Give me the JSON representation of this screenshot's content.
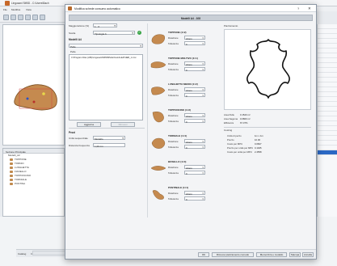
{
  "background_app": {
    "title": "Lingusani Sift5D - C:\\Users\\Bach",
    "menu": [
      "File",
      "Modifica",
      "Vista"
    ],
    "panel_title": "Sezione Principale",
    "tree_root": "Modelli_A2",
    "tree_items": [
      "TOPPONE",
      "TORNIO",
      "LUNGHETTA",
      "FIANELLO",
      "TOPPONCINO",
      "TORNIALE",
      "PUNTINA"
    ],
    "bottom_tabs": [
      "Catalog",
      "Impaginazione pagine",
      "apri pacchetto",
      "Applica e trasferisci pacchetto",
      "Extra"
    ]
  },
  "dialog": {
    "title": "Modifica schede consumo automatico",
    "help_label": "?",
    "close_label": "✕",
    "header": "Modelli A4 - 108",
    "left": {
      "magnification_label": "Maggiorazione (%)",
      "magnification_value": "1 - 0",
      "choice_label": "Scelta",
      "choice_value": "Tipologia A",
      "selection_title": "Modelli A4",
      "type_value": "Pelle",
      "list_label": "Pelle",
      "list_item": "C:\\Program Files (x86)\\Lingusani\\Sift5D\\Pelle\\Cuoio\\LEATHER_1.cmx",
      "apply_button": "Aggiorna",
      "remove_button": "Rimuovi",
      "shoes_title": "Pezzi",
      "unit_label": "Unità sequenziale",
      "unit_value": "Modello",
      "display_label": "Distanza frequenza",
      "display_value": "1,00 cm"
    },
    "pieces": [
      {
        "name": "TOPPONE (1×2)",
        "rotation": "Libero",
        "tolerance": "0"
      },
      {
        "name": "TOPPONE MOLTIVO (1×1)",
        "rotation": "Libero",
        "tolerance": "0"
      },
      {
        "name": "LUNGHETTA MEDIO (1×2)",
        "rotation": "Libero",
        "tolerance": "0"
      },
      {
        "name": "TOPPONCINO (1×2)",
        "rotation": "Libero",
        "tolerance": "0"
      },
      {
        "name": "TORNIALE (1×1)",
        "rotation": "Libero",
        "tolerance": "0"
      },
      {
        "name": "BOSELLO (1×4)",
        "rotation": "Libero",
        "tolerance": "0"
      },
      {
        "name": "PUNTINALE (1×1)",
        "rotation": "Libero",
        "tolerance": "0"
      }
    ],
    "piece_labels": {
      "rotation": "Rotazione",
      "tolerance": "Tolleranza"
    },
    "right": {
      "preview_title": "Piazzamento",
      "area_pelle_label": "Area Pelle",
      "area_pelle_value": "0.1520 m²",
      "area_sagoma_label": "Area Sagoma",
      "area_sagoma_value": "0.0800 m²",
      "efficiency_label": "Efficienza",
      "efficiency_value": "67.07%",
      "costing_title": "Costing",
      "cost_rows": [
        {
          "label": "Unità di pezzo",
          "value": "1m x 1m"
        },
        {
          "label": "Prezzo",
          "value": "10.00"
        },
        {
          "label": "Costo per MPU",
          "value": "0.0827"
        },
        {
          "label": "Prezzo per unità per MPU",
          "value": "0.1945"
        },
        {
          "label": "Costo per unità per MPU",
          "value": "2.4558"
        }
      ]
    },
    "footer": {
      "ok": "OK",
      "reset_label": "Rimuovi piazzamento comodo",
      "save_label": "Memorizza e modello",
      "print_label": "Stampa",
      "cancel_label": "Annulla"
    }
  },
  "colors": {
    "leather_piece": "#c58a4f",
    "accent_green": "#3aa548",
    "selection_blue": "#2b68c4"
  }
}
